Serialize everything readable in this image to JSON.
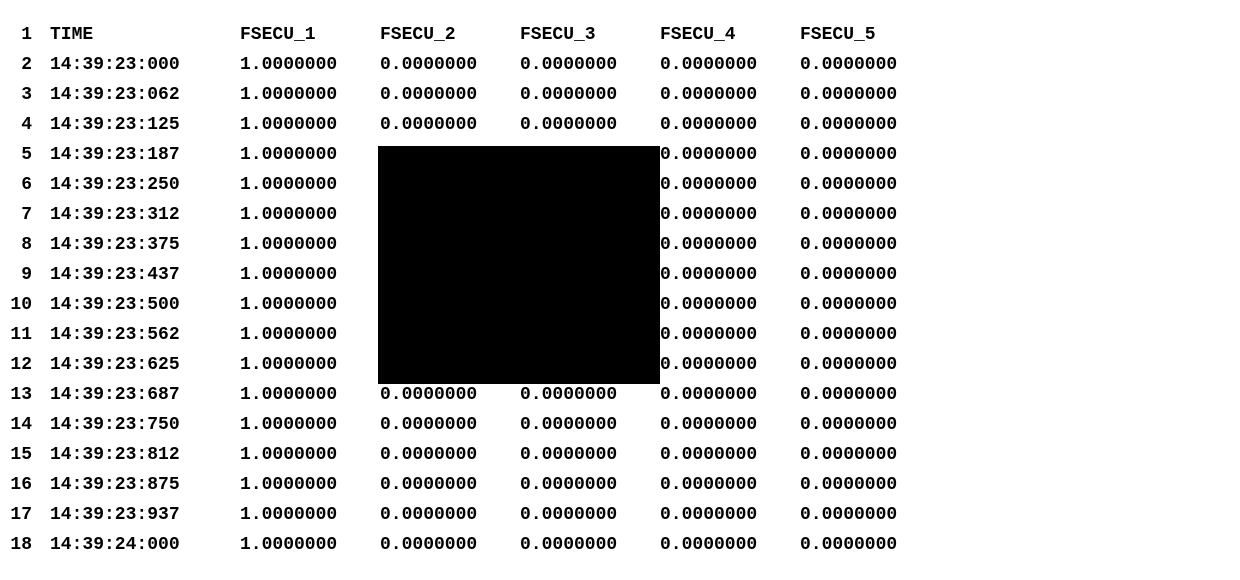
{
  "columns": [
    "TIME",
    "FSECU_1",
    "FSECU_2",
    "FSECU_3",
    "FSECU_4",
    "FSECU_5"
  ],
  "rows": [
    {
      "n": 1,
      "time": "TIME",
      "v1": "FSECU_1",
      "v2": "FSECU_2",
      "v3": "FSECU_3",
      "v4": "FSECU_4",
      "v5": "FSECU_5"
    },
    {
      "n": 2,
      "time": "14:39:23:000",
      "v1": "1.0000000",
      "v2": "0.0000000",
      "v3": "0.0000000",
      "v4": "0.0000000",
      "v5": "0.0000000"
    },
    {
      "n": 3,
      "time": "14:39:23:062",
      "v1": "1.0000000",
      "v2": "0.0000000",
      "v3": "0.0000000",
      "v4": "0.0000000",
      "v5": "0.0000000"
    },
    {
      "n": 4,
      "time": "14:39:23:125",
      "v1": "1.0000000",
      "v2": "0.0000000",
      "v3": "0.0000000",
      "v4": "0.0000000",
      "v5": "0.0000000"
    },
    {
      "n": 5,
      "time": "14:39:23:187",
      "v1": "1.0000000",
      "v2": "",
      "v3": "",
      "v4": "0.0000000",
      "v5": "0.0000000"
    },
    {
      "n": 6,
      "time": "14:39:23:250",
      "v1": "1.0000000",
      "v2": "",
      "v3": "",
      "v4": "0.0000000",
      "v5": "0.0000000"
    },
    {
      "n": 7,
      "time": "14:39:23:312",
      "v1": "1.0000000",
      "v2": "",
      "v3": "",
      "v4": "0.0000000",
      "v5": "0.0000000"
    },
    {
      "n": 8,
      "time": "14:39:23:375",
      "v1": "1.0000000",
      "v2": "",
      "v3": "",
      "v4": "0.0000000",
      "v5": "0.0000000"
    },
    {
      "n": 9,
      "time": "14:39:23:437",
      "v1": "1.0000000",
      "v2": "",
      "v3": "",
      "v4": "0.0000000",
      "v5": "0.0000000"
    },
    {
      "n": 10,
      "time": "14:39:23:500",
      "v1": "1.0000000",
      "v2": "",
      "v3": "",
      "v4": "0.0000000",
      "v5": "0.0000000"
    },
    {
      "n": 11,
      "time": "14:39:23:562",
      "v1": "1.0000000",
      "v2": "",
      "v3": "",
      "v4": "0.0000000",
      "v5": "0.0000000"
    },
    {
      "n": 12,
      "time": "14:39:23:625",
      "v1": "1.0000000",
      "v2": "",
      "v3": "",
      "v4": "0.0000000",
      "v5": "0.0000000"
    },
    {
      "n": 13,
      "time": "14:39:23:687",
      "v1": "1.0000000",
      "v2": "0.0000000",
      "v3": "0.0000000",
      "v4": "0.0000000",
      "v5": "0.0000000"
    },
    {
      "n": 14,
      "time": "14:39:23:750",
      "v1": "1.0000000",
      "v2": "0.0000000",
      "v3": "0.0000000",
      "v4": "0.0000000",
      "v5": "0.0000000"
    },
    {
      "n": 15,
      "time": "14:39:23:812",
      "v1": "1.0000000",
      "v2": "0.0000000",
      "v3": "0.0000000",
      "v4": "0.0000000",
      "v5": "0.0000000"
    },
    {
      "n": 16,
      "time": "14:39:23:875",
      "v1": "1.0000000",
      "v2": "0.0000000",
      "v3": "0.0000000",
      "v4": "0.0000000",
      "v5": "0.0000000"
    },
    {
      "n": 17,
      "time": "14:39:23:937",
      "v1": "1.0000000",
      "v2": "0.0000000",
      "v3": "0.0000000",
      "v4": "0.0000000",
      "v5": "0.0000000"
    },
    {
      "n": 18,
      "time": "14:39:24:000",
      "v1": "1.0000000",
      "v2": "0.0000000",
      "v3": "0.0000000",
      "v4": "0.0000000",
      "v5": "0.0000000"
    }
  ],
  "redaction": {
    "top_row": 5,
    "bottom_row": 12,
    "left_col": "v2",
    "right_col": "v3"
  }
}
